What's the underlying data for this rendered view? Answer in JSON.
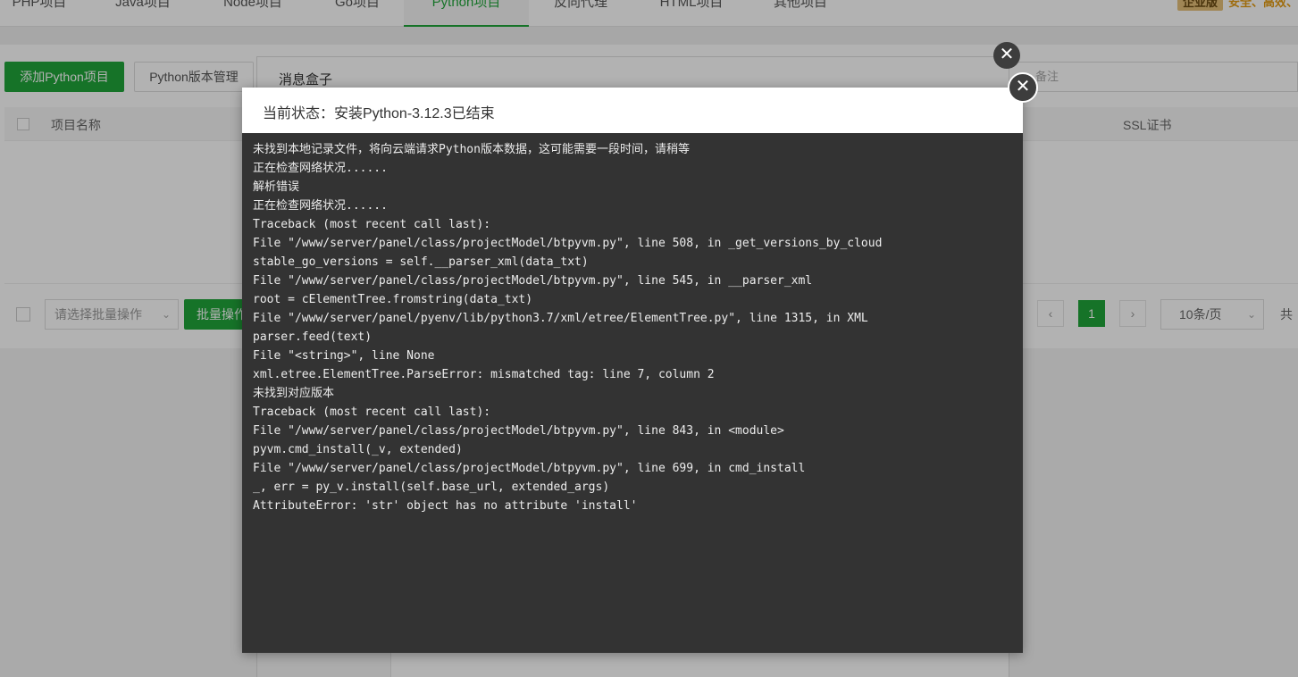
{
  "nav": {
    "tabs": [
      {
        "label": "PHP项目"
      },
      {
        "label": "Java项目"
      },
      {
        "label": "Node项目"
      },
      {
        "label": "Go项目"
      },
      {
        "label": "Python项目"
      },
      {
        "label": "反向代理"
      },
      {
        "label": "HTML项目"
      },
      {
        "label": "其他项目"
      }
    ],
    "active_index": 4,
    "brand_badge": "企业版",
    "brand_slogan": "安全、高效、"
  },
  "toolbar": {
    "add_button": "添加Python项目",
    "version_button": "Python版本管理",
    "search_placeholder": "备注"
  },
  "table": {
    "headers": {
      "name": "项目名称",
      "ssl": "SSL证书"
    }
  },
  "footer": {
    "batch_select_placeholder": "请选择批量操作",
    "batch_button": "批量操作",
    "pagination": {
      "prev": "‹",
      "current": "1",
      "next": "›",
      "page_size": "10条/页",
      "total_prefix": "共"
    }
  },
  "message_box": {
    "title": "消息盒子"
  },
  "dialog": {
    "status_label": "当前状态：安装Python-3.12.3已结束",
    "log_lines": [
      "未找到本地记录文件，将向云端请求Python版本数据，这可能需要一段时间，请稍等",
      "正在检查网络状况......",
      "解析错误",
      "正在检查网络状况......",
      "Traceback (most recent call last):",
      "File \"/www/server/panel/class/projectModel/btpyvm.py\", line 508, in _get_versions_by_cloud",
      "stable_go_versions = self.__parser_xml(data_txt)",
      "File \"/www/server/panel/class/projectModel/btpyvm.py\", line 545, in __parser_xml",
      "root = cElementTree.fromstring(data_txt)",
      "File \"/www/server/panel/pyenv/lib/python3.7/xml/etree/ElementTree.py\", line 1315, in XML",
      "parser.feed(text)",
      "File \"<string>\", line None",
      "xml.etree.ElementTree.ParseError: mismatched tag: line 7, column 2",
      "未找到对应版本",
      "Traceback (most recent call last):",
      "File \"/www/server/panel/class/projectModel/btpyvm.py\", line 843, in <module>",
      "pyvm.cmd_install(_v, extended)",
      "File \"/www/server/panel/class/projectModel/btpyvm.py\", line 699, in cmd_install",
      "_, err = py_v.install(self.base_url, extended_args)",
      "AttributeError: 'str' object has no attribute 'install'"
    ]
  },
  "icons": {
    "close": "close-icon"
  },
  "colors": {
    "accent": "#20a53a",
    "console_bg": "#333333",
    "console_text": "#ececec"
  }
}
